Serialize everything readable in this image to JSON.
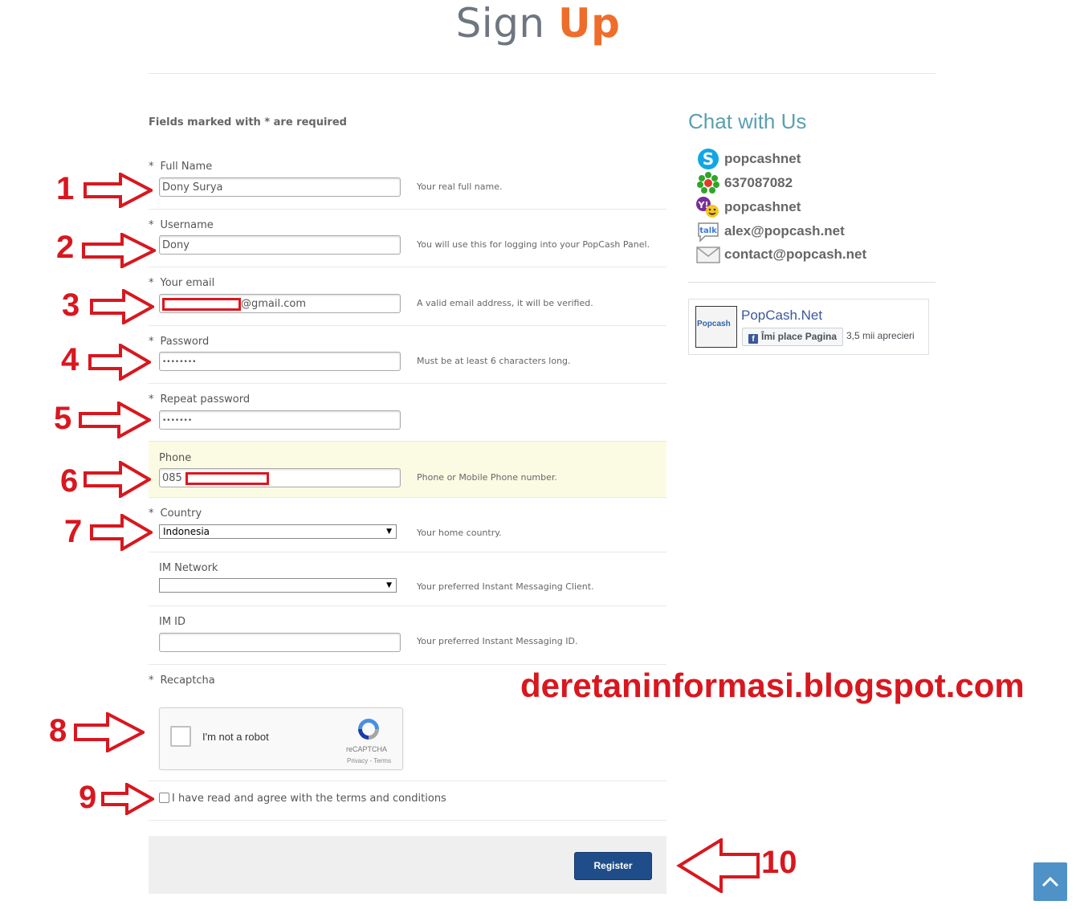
{
  "title": {
    "part1": "Sign",
    "part2": "Up"
  },
  "required_note": "Fields marked with * are required",
  "fields": {
    "full_name": {
      "label": "Full Name",
      "value": "Dony Surya",
      "hint": "Your real full name."
    },
    "username": {
      "label": "Username",
      "value": "Dony",
      "hint": "You will use this for logging into your PopCash Panel."
    },
    "email": {
      "label": "Your email",
      "value_suffix": "@gmail.com",
      "hint": "A valid email address, it will be verified."
    },
    "password": {
      "label": "Password",
      "value": "••••••••",
      "hint": "Must be at least 6 characters long."
    },
    "repeat_password": {
      "label": "Repeat password",
      "value": "•••••••"
    },
    "phone": {
      "label": "Phone",
      "value_prefix": "085",
      "hint": "Phone or Mobile Phone number."
    },
    "country": {
      "label": "Country",
      "value": "Indonesia",
      "hint": "Your home country."
    },
    "im_network": {
      "label": "IM Network",
      "value": "",
      "hint": "Your preferred Instant Messaging Client."
    },
    "im_id": {
      "label": "IM ID",
      "value": "",
      "hint": "Your preferred Instant Messaging ID."
    },
    "recaptcha": {
      "label": "Recaptcha"
    }
  },
  "required_star": "*",
  "captcha": {
    "text": "I'm not a robot",
    "brand": "reCAPTCHA",
    "links": "Privacy - Terms"
  },
  "terms": {
    "label": "I have read and agree with the terms and conditions"
  },
  "register_label": "Register",
  "sidebar": {
    "chat_title": "Chat with Us",
    "items": [
      {
        "icon": "skype-icon",
        "text": "popcashnet"
      },
      {
        "icon": "icq-icon",
        "text": "637087082"
      },
      {
        "icon": "yahoo-messenger-icon",
        "text": "popcashnet"
      },
      {
        "icon": "google-talk-icon",
        "text": "alex@popcash.net"
      },
      {
        "icon": "mail-icon",
        "text": "contact@popcash.net"
      }
    ],
    "fb": {
      "logo_text": "Popcash",
      "name": "PopCash.Net",
      "like": "Îmi place Pagina",
      "count": "3,5 mii aprecieri"
    }
  },
  "annotations": [
    "1",
    "2",
    "3",
    "4",
    "5",
    "6",
    "7",
    "8",
    "9",
    "10"
  ],
  "watermark": "deretaninformasi.blogspot.com",
  "colors": {
    "accent": "#ef6d2a",
    "annotation": "#d8171f",
    "register": "#1f4d8a",
    "chat_title": "#5aa0b0",
    "highlight_row": "#fbfbe4"
  }
}
